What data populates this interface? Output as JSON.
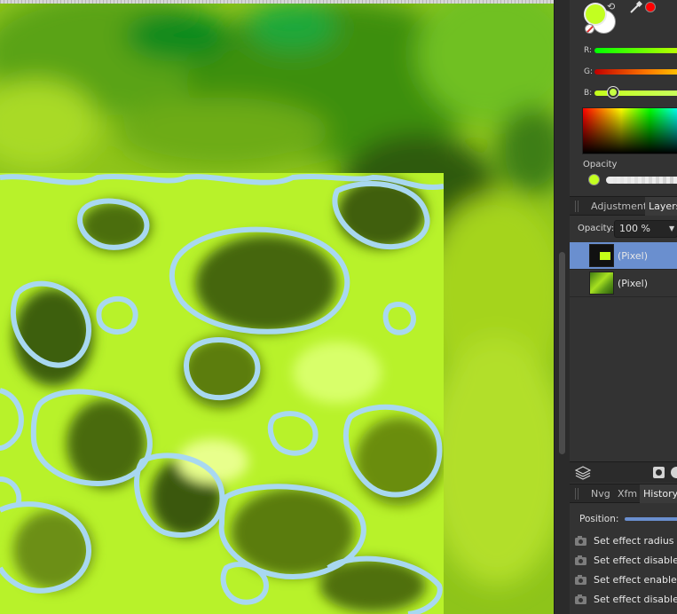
{
  "color_panel": {
    "fill_color": "#c2ff20",
    "stroke_color": "#ffffff",
    "picked_color": "#ff0000",
    "channels": [
      {
        "label": "R:"
      },
      {
        "label": "G:"
      },
      {
        "label": "B:"
      }
    ],
    "opacity_label": "Opacity"
  },
  "top_tabs": {
    "adjustment": "Adjustment",
    "layers": "Layers",
    "active": "layers"
  },
  "layers": {
    "opacity_label": "Opacity:",
    "opacity_value": "100 %",
    "items": [
      {
        "name": "(Pixel)",
        "selected": true
      },
      {
        "name": "(Pixel)",
        "selected": false
      }
    ]
  },
  "bottom_tabs": {
    "nvg": "Nvg",
    "xfm": "Xfm",
    "history": "History",
    "active": "history"
  },
  "history": {
    "position_label": "Position:",
    "items": [
      {
        "label": "Set effect radius",
        "icon": "camera-icon"
      },
      {
        "label": "Set effect disabled",
        "icon": "camera-icon"
      },
      {
        "label": "Set effect enabled",
        "icon": "camera-icon"
      },
      {
        "label": "Set effect disabled",
        "icon": "camera-icon"
      }
    ]
  },
  "colors": {
    "selection_blue": "#a8d8f0",
    "accent_blue": "#6a8fcf",
    "panel_bg": "#333333"
  }
}
